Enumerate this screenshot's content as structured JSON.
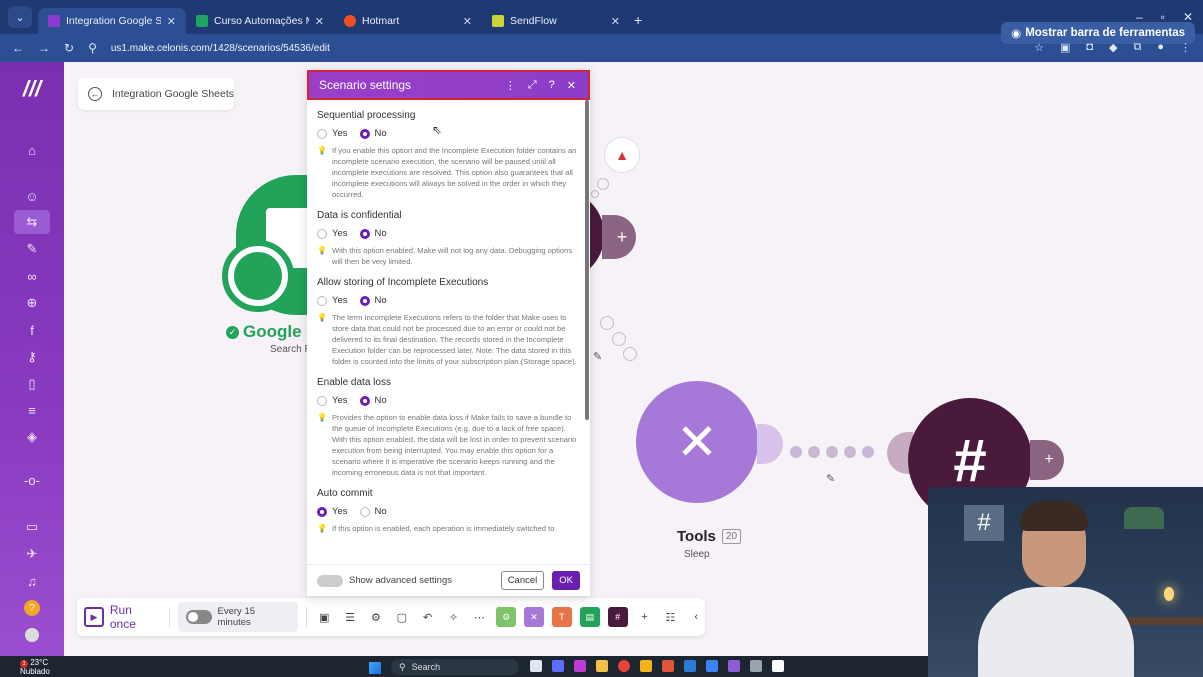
{
  "browser": {
    "tabs": [
      {
        "title": "Integration Google Sheets | Ma",
        "active": true
      },
      {
        "title": "Curso Automações Make - CST",
        "active": false
      },
      {
        "title": "Hotmart",
        "active": false
      },
      {
        "title": "SendFlow",
        "active": false
      }
    ],
    "url": "us1.make.celonis.com/1428/scenarios/54536/edit",
    "toolbar_button": "Mostrar barra de ferramentas"
  },
  "scenario": {
    "back_label": "Integration Google Sheets"
  },
  "modules": {
    "google_sheets": {
      "title": "Google S",
      "subtitle": "Search R"
    },
    "tools": {
      "title": "Tools",
      "badge": "20",
      "subtitle": "Sleep"
    }
  },
  "dialog": {
    "title": "Scenario settings",
    "yes": "Yes",
    "no": "No",
    "sections": [
      {
        "title": "Sequential processing",
        "selected": "No",
        "hint": "If you enable this option and the Incomplete Execution folder contains an incomplete scenario execution, the scenario will be paused until all incomplete executions are resolved. This option also guarantees that all incomplete executions will always be solved in the order in which they occurred."
      },
      {
        "title": "Data is confidential",
        "selected": "No",
        "hint": "With this option enabled, Make will not log any data. Debugging options will then be very limited."
      },
      {
        "title": "Allow storing of Incomplete Executions",
        "selected": "No",
        "hint": "The term Incomplete Executions refers to the folder that Make uses to store data that could not be processed due to an error or could not be delivered to its final destination. The records stored in the Incomplete Execution folder can be reprocessed later. Note: The data stored in this folder is counted into the limits of your subscription plan (Storage space)."
      },
      {
        "title": "Enable data loss",
        "selected": "No",
        "hint": "Provides the option to enable data loss if Make fails to save a bundle to the queue of Incomplete Executions (e.g. due to a lack of free space). With this option enabled, the data will be lost in order to prevent scenario execution from being interrupted. You may enable this option for a scenario where it is imperative the scenario keeps running and the incoming erroneous data is not that important."
      },
      {
        "title": "Auto commit",
        "selected": "Yes",
        "hint": "If this option is enabled, each operation is immediately switched to"
      }
    ],
    "advanced_label": "Show advanced settings",
    "cancel_label": "Cancel",
    "ok_label": "OK"
  },
  "bottom_toolbar": {
    "run_once": "Run once",
    "schedule": "Every 15 minutes"
  },
  "taskbar": {
    "temp": "23°C",
    "weather": "Nublado",
    "notif_count": "1",
    "search_placeholder": "Search"
  },
  "colors": {
    "make_purple": "#6a1fb0",
    "sidebar": "#7a2fb0",
    "google_green": "#22a35a",
    "tools_purple": "#a679d8",
    "slack_aubergine": "#4a1a3c"
  }
}
